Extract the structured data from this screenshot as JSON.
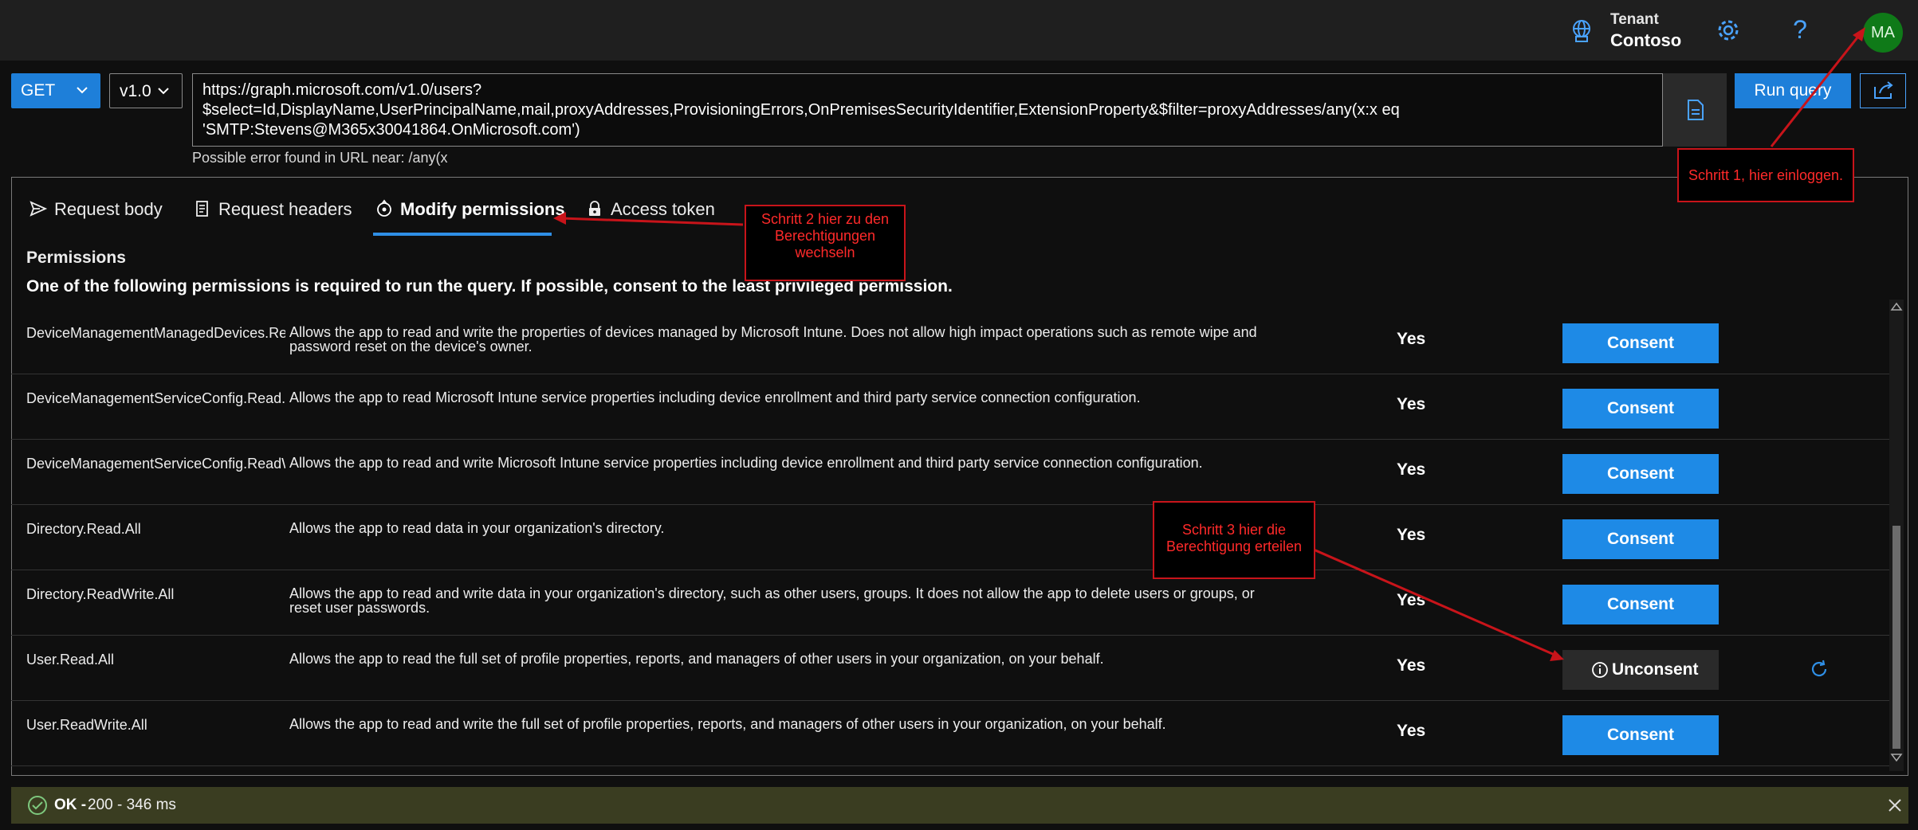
{
  "header": {
    "tenant_label": "Tenant",
    "tenant_name": "Contoso",
    "avatar_initials": "MA",
    "help_glyph": "?",
    "icons": [
      "tenant-icon",
      "gear-icon",
      "help-icon"
    ]
  },
  "query": {
    "method": "GET",
    "version": "v1.0",
    "url": "https://graph.microsoft.com/v1.0/users?\n$select=Id,DisplayName,UserPrincipalName,mail,proxyAddresses,ProvisioningErrors,OnPremisesSecurityIdentifier,ExtensionProperty&$filter=proxyAddresses/any(x:x eq\n'SMTP:Stevens@M365x30041864.OnMicrosoft.com')",
    "run_label": "Run query",
    "error_hint": "Possible error found in URL near: /any(x"
  },
  "tabs": {
    "request_body": "Request body",
    "request_headers": "Request headers",
    "modify_permissions": "Modify permissions",
    "access_token": "Access token",
    "active": "modify_permissions"
  },
  "permissions": {
    "heading": "Permissions",
    "subheading": "One of the following permissions is required to run the query. If possible, consent to the least privileged permission.",
    "rows": [
      {
        "name": "DeviceManagementManagedDevices.ReadWrite.All",
        "description": "Allows the app to read and write the properties of devices managed by Microsoft Intune. Does not allow high impact operations such as remote wipe and password reset on the device's owner.",
        "admin": "Yes",
        "action": "Consent"
      },
      {
        "name": "DeviceManagementServiceConfig.Read.All",
        "description": "Allows the app to read Microsoft Intune service properties including device enrollment and third party service connection configuration.",
        "admin": "Yes",
        "action": "Consent"
      },
      {
        "name": "DeviceManagementServiceConfig.ReadWrite.All",
        "description": "Allows the app to read and write Microsoft Intune service properties including device enrollment and third party service connection configuration.",
        "admin": "Yes",
        "action": "Consent"
      },
      {
        "name": "Directory.Read.All",
        "description": "Allows the app to read data in your organization's directory.",
        "admin": "Yes",
        "action": "Consent"
      },
      {
        "name": "Directory.ReadWrite.All",
        "description": "Allows the app to read and write data in your organization's directory, such as other users, groups. It does not allow the app to delete users or groups, or reset user passwords.",
        "admin": "Yes",
        "action": "Consent"
      },
      {
        "name": "User.Read.All",
        "description": "Allows the app to read the full set of profile properties, reports, and managers of other users in your organization, on your behalf.",
        "admin": "Yes",
        "action": "Unconsent"
      },
      {
        "name": "User.ReadWrite.All",
        "description": "Allows the app to read and write the full set of profile properties, reports, and managers of other users in your organization, on your behalf.",
        "admin": "Yes",
        "action": "Consent"
      }
    ]
  },
  "status": {
    "ok": "OK -",
    "detail": "200 - 346 ms"
  },
  "annotations": {
    "step1": "Schritt 1, hier einloggen.",
    "step2": "Schritt 2 hier zu den Berechtigungen wechseln",
    "step3": "Schritt 3 hier die Berechtigung erteilen"
  },
  "colors": {
    "accent": "#1e8ae6",
    "annotation": "#c8141a",
    "status_bg": "#3a3d21",
    "avatar_bg": "#0f7a18"
  }
}
